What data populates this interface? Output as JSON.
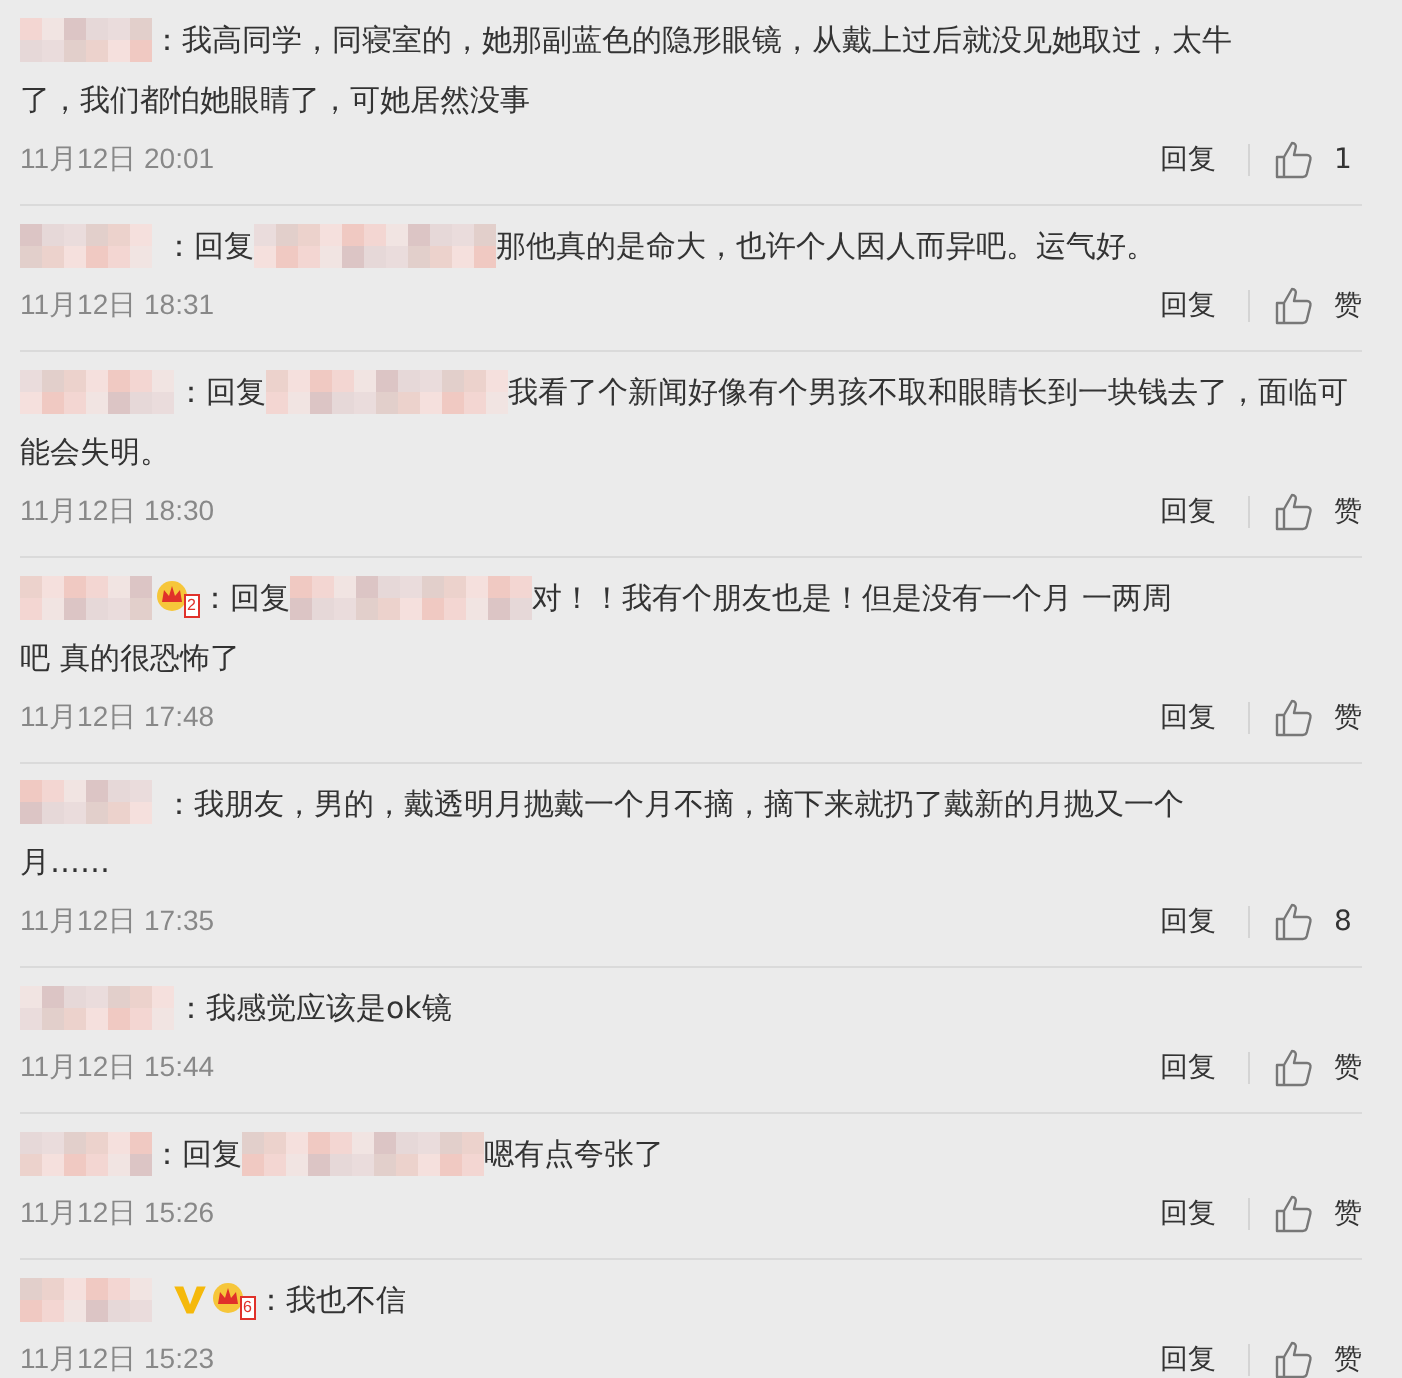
{
  "comments": [
    {
      "segments": [
        {
          "kind": "masked"
        },
        {
          "kind": "text",
          "text": "：我高同学，同寝室的，她那副蓝色的隐形眼镜，从戴上过后就没见她取过，太牛"
        },
        {
          "kind": "line",
          "text": "了，我们都怕她眼睛了，可她居然没事"
        }
      ],
      "time": "11月12日 20:01",
      "reply": "回复",
      "like": "1"
    },
    {
      "segments": [
        {
          "kind": "masked"
        },
        {
          "kind": "text",
          "text": "：回复"
        },
        {
          "kind": "masked"
        },
        {
          "kind": "text",
          "text": "那他真的是命大，也许个人因人而异吧。运气好。"
        }
      ],
      "time": "11月12日 18:31",
      "reply": "回复",
      "like": "赞"
    },
    {
      "segments": [
        {
          "kind": "masked"
        },
        {
          "kind": "text",
          "text": "：回复"
        },
        {
          "kind": "masked"
        },
        {
          "kind": "text",
          "text": "我看了个新闻好像有个男孩不取和眼睛长到一块钱去了，面临可"
        },
        {
          "kind": "line",
          "text": "能会失明。"
        }
      ],
      "time": "11月12日 18:30",
      "reply": "回复",
      "like": "赞"
    },
    {
      "segments": [
        {
          "kind": "masked"
        },
        {
          "kind": "crown",
          "label": "2"
        },
        {
          "kind": "text",
          "text": "：回复"
        },
        {
          "kind": "masked"
        },
        {
          "kind": "text",
          "text": "对！！我有个朋友也是！但是没有一个月 一两周"
        },
        {
          "kind": "line",
          "text": "吧 真的很恐怖了"
        }
      ],
      "time": "11月12日 17:48",
      "reply": "回复",
      "like": "赞"
    },
    {
      "segments": [
        {
          "kind": "masked"
        },
        {
          "kind": "text",
          "text": "：我朋友，男的，戴透明月抛戴一个月不摘，摘下来就扔了戴新的月抛又一个"
        },
        {
          "kind": "line",
          "text": "月……"
        }
      ],
      "time": "11月12日 17:35",
      "reply": "回复",
      "like": "8"
    },
    {
      "segments": [
        {
          "kind": "masked"
        },
        {
          "kind": "text",
          "text": "：我感觉应该是ok镜"
        }
      ],
      "time": "11月12日 15:44",
      "reply": "回复",
      "like": "赞"
    },
    {
      "segments": [
        {
          "kind": "masked"
        },
        {
          "kind": "text",
          "text": "：回复"
        },
        {
          "kind": "masked"
        },
        {
          "kind": "text",
          "text": "嗯有点夸张了"
        }
      ],
      "time": "11月12日 15:26",
      "reply": "回复",
      "like": "赞"
    },
    {
      "segments": [
        {
          "kind": "masked"
        },
        {
          "kind": "verified"
        },
        {
          "kind": "crown",
          "label": "6"
        },
        {
          "kind": "text",
          "text": "：我也不信"
        }
      ],
      "time": "11月12日 15:23",
      "reply": "回复",
      "like": "赞"
    }
  ]
}
